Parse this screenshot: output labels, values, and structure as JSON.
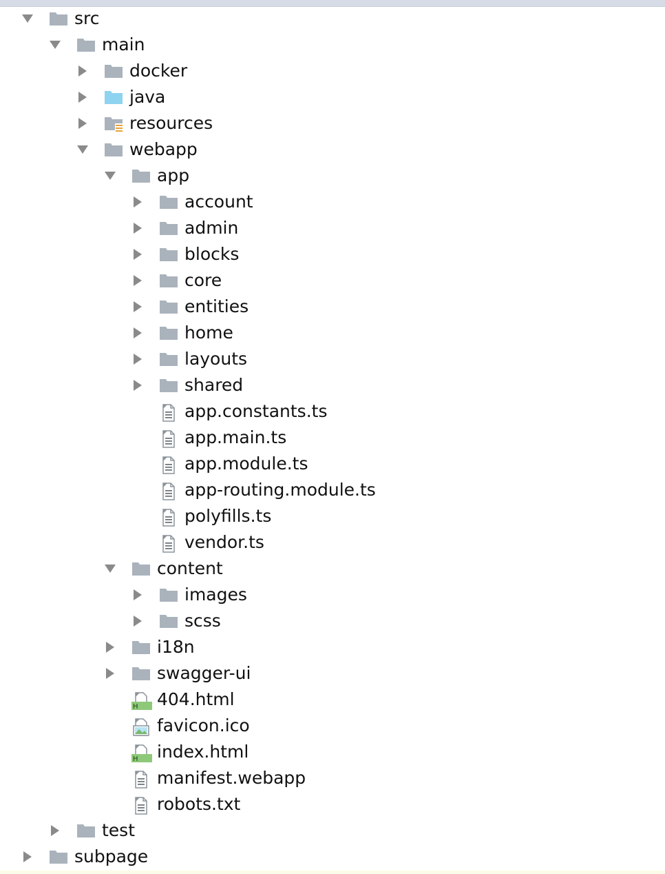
{
  "colors": {
    "folder": "#aab3bc",
    "java_folder": "#8ed3f0",
    "arrow": "#8a8a8a",
    "text": "#111111",
    "html_badge": "#8ec97a",
    "resources_badge": "#e8a232"
  },
  "tree": [
    {
      "label": "src",
      "depth": 0,
      "kind": "folder",
      "icon": "folder-icon",
      "state": "expanded"
    },
    {
      "label": "main",
      "depth": 1,
      "kind": "folder",
      "icon": "folder-icon",
      "state": "expanded"
    },
    {
      "label": "docker",
      "depth": 2,
      "kind": "folder",
      "icon": "folder-icon",
      "state": "collapsed"
    },
    {
      "label": "java",
      "depth": 2,
      "kind": "folder",
      "icon": "source-folder-icon",
      "state": "collapsed"
    },
    {
      "label": "resources",
      "depth": 2,
      "kind": "folder",
      "icon": "resources-folder-icon",
      "state": "collapsed"
    },
    {
      "label": "webapp",
      "depth": 2,
      "kind": "folder",
      "icon": "folder-icon",
      "state": "expanded"
    },
    {
      "label": "app",
      "depth": 3,
      "kind": "folder",
      "icon": "folder-icon",
      "state": "expanded"
    },
    {
      "label": "account",
      "depth": 4,
      "kind": "folder",
      "icon": "folder-icon",
      "state": "collapsed"
    },
    {
      "label": "admin",
      "depth": 4,
      "kind": "folder",
      "icon": "folder-icon",
      "state": "collapsed"
    },
    {
      "label": "blocks",
      "depth": 4,
      "kind": "folder",
      "icon": "folder-icon",
      "state": "collapsed"
    },
    {
      "label": "core",
      "depth": 4,
      "kind": "folder",
      "icon": "folder-icon",
      "state": "collapsed"
    },
    {
      "label": "entities",
      "depth": 4,
      "kind": "folder",
      "icon": "folder-icon",
      "state": "collapsed"
    },
    {
      "label": "home",
      "depth": 4,
      "kind": "folder",
      "icon": "folder-icon",
      "state": "collapsed"
    },
    {
      "label": "layouts",
      "depth": 4,
      "kind": "folder",
      "icon": "folder-icon",
      "state": "collapsed"
    },
    {
      "label": "shared",
      "depth": 4,
      "kind": "folder",
      "icon": "folder-icon",
      "state": "collapsed"
    },
    {
      "label": "app.constants.ts",
      "depth": 4,
      "kind": "file",
      "icon": "text-file-icon",
      "state": "none"
    },
    {
      "label": "app.main.ts",
      "depth": 4,
      "kind": "file",
      "icon": "text-file-icon",
      "state": "none"
    },
    {
      "label": "app.module.ts",
      "depth": 4,
      "kind": "file",
      "icon": "text-file-icon",
      "state": "none"
    },
    {
      "label": "app-routing.module.ts",
      "depth": 4,
      "kind": "file",
      "icon": "text-file-icon",
      "state": "none"
    },
    {
      "label": "polyfills.ts",
      "depth": 4,
      "kind": "file",
      "icon": "text-file-icon",
      "state": "none"
    },
    {
      "label": "vendor.ts",
      "depth": 4,
      "kind": "file",
      "icon": "text-file-icon",
      "state": "none"
    },
    {
      "label": "content",
      "depth": 3,
      "kind": "folder",
      "icon": "folder-icon",
      "state": "expanded"
    },
    {
      "label": "images",
      "depth": 4,
      "kind": "folder",
      "icon": "folder-icon",
      "state": "collapsed"
    },
    {
      "label": "scss",
      "depth": 4,
      "kind": "folder",
      "icon": "folder-icon",
      "state": "collapsed"
    },
    {
      "label": "i18n",
      "depth": 3,
      "kind": "folder",
      "icon": "folder-icon",
      "state": "collapsed"
    },
    {
      "label": "swagger-ui",
      "depth": 3,
      "kind": "folder",
      "icon": "folder-icon",
      "state": "collapsed"
    },
    {
      "label": "404.html",
      "depth": 3,
      "kind": "file",
      "icon": "html-file-icon",
      "state": "none"
    },
    {
      "label": "favicon.ico",
      "depth": 3,
      "kind": "file",
      "icon": "image-file-icon",
      "state": "none"
    },
    {
      "label": "index.html",
      "depth": 3,
      "kind": "file",
      "icon": "html-file-icon",
      "state": "none"
    },
    {
      "label": "manifest.webapp",
      "depth": 3,
      "kind": "file",
      "icon": "text-file-icon",
      "state": "none"
    },
    {
      "label": "robots.txt",
      "depth": 3,
      "kind": "file",
      "icon": "text-file-icon",
      "state": "none"
    },
    {
      "label": "test",
      "depth": 1,
      "kind": "folder",
      "icon": "folder-icon",
      "state": "collapsed"
    },
    {
      "label": "subpage",
      "depth": 0,
      "kind": "folder",
      "icon": "folder-icon",
      "state": "collapsed"
    }
  ]
}
